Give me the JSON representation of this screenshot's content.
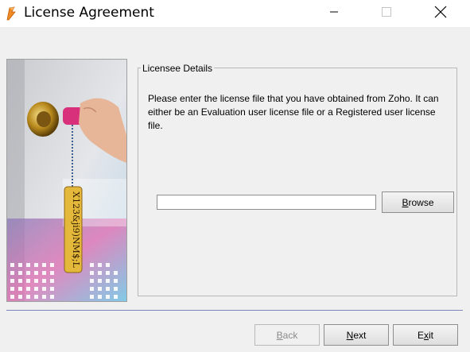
{
  "window": {
    "title": "License Agreement",
    "icon": "app-icon",
    "minimize_icon": "minimize-icon",
    "maximize_icon": "maximize-icon",
    "close_icon": "close-icon"
  },
  "side_image": {
    "tag_text": "X123&ji9)NM$;L"
  },
  "licensee": {
    "legend": "Licensee Details",
    "description": "Please enter the license file that you have obtained from Zoho. It can either be an Evaluation user license file or a Registered user license file.",
    "file_path_value": "",
    "browse": {
      "label_mnemonic": "B",
      "label_rest": "rowse"
    }
  },
  "footer": {
    "back": {
      "label_mnemonic": "B",
      "label_rest": "ack",
      "enabled": false
    },
    "next": {
      "label_mnemonic": "N",
      "label_rest": "ext"
    },
    "exit": {
      "label_first": "E",
      "label_mnemonic": "x",
      "label_rest": "it"
    }
  }
}
